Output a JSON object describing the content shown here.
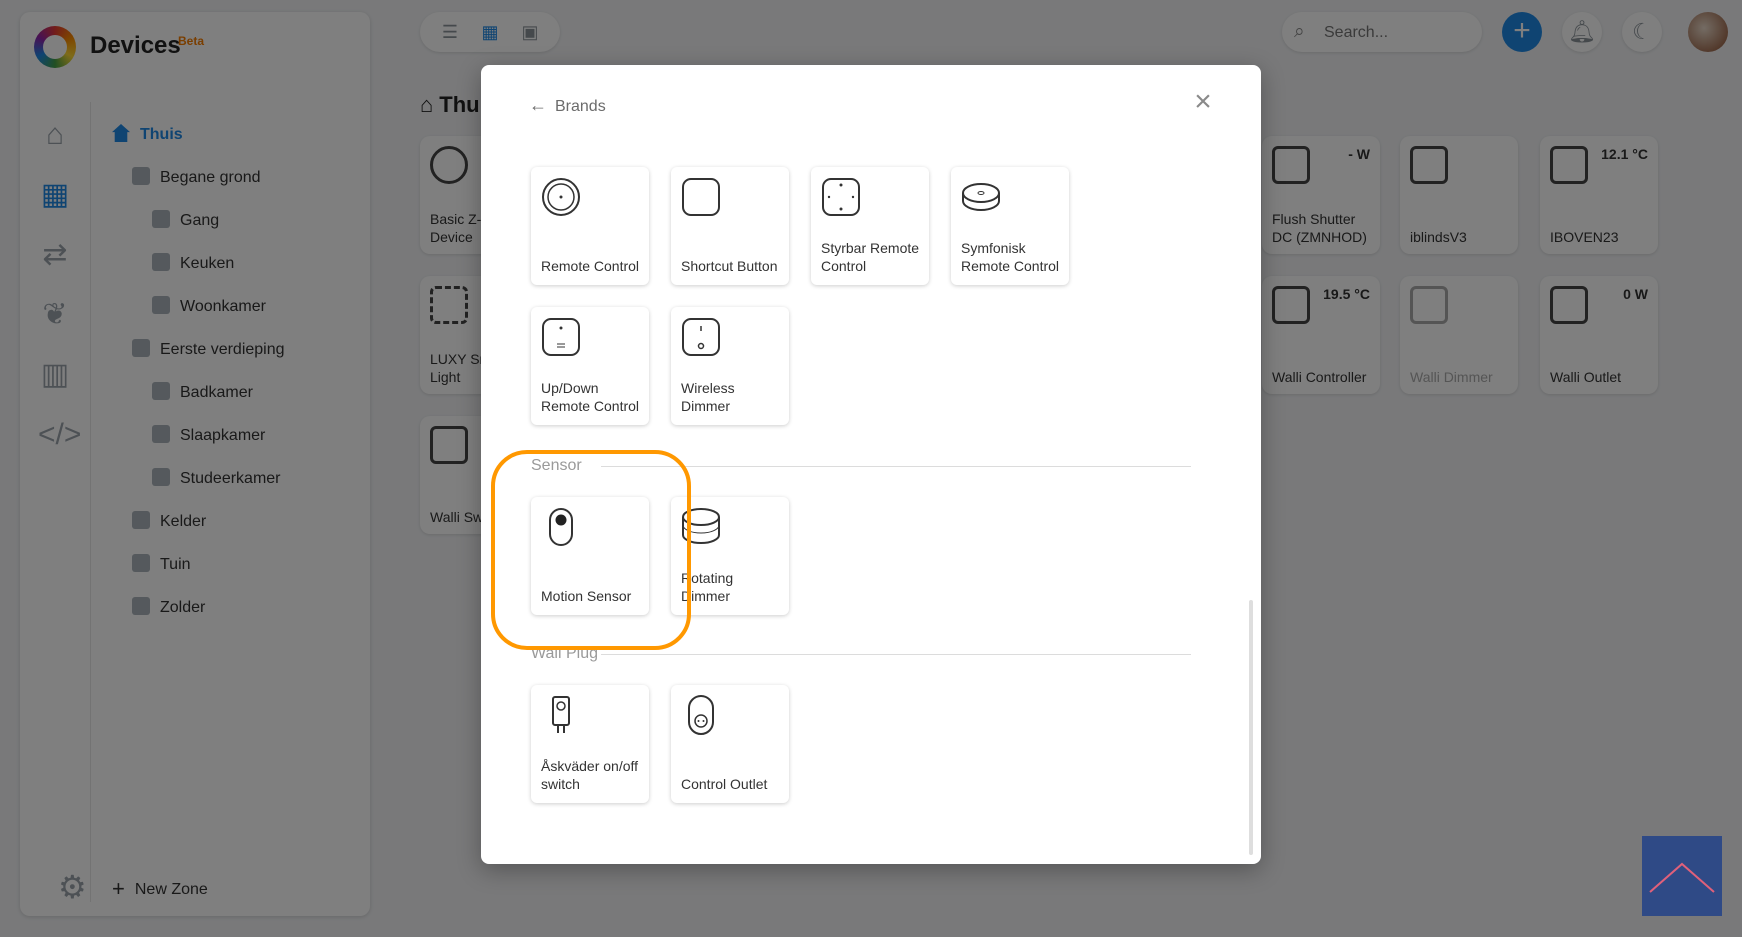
{
  "app": {
    "title": "Devices",
    "badge": "Beta",
    "accent_color": "#1e88e5",
    "highlight_color": "#ff9800"
  },
  "rail": [
    {
      "name": "home-icon",
      "active": false
    },
    {
      "name": "devices-grid-icon",
      "active": true
    },
    {
      "name": "flows-shuffle-icon",
      "active": false
    },
    {
      "name": "energy-leaf-icon",
      "active": false
    },
    {
      "name": "insights-chart-icon",
      "active": false
    },
    {
      "name": "developer-code-icon",
      "active": false
    }
  ],
  "zones": {
    "items": [
      {
        "label": "Thuis",
        "active": true
      },
      {
        "label": "Begane grond"
      },
      {
        "label": "Gang"
      },
      {
        "label": "Keuken"
      },
      {
        "label": "Woonkamer"
      },
      {
        "label": "Eerste verdieping"
      },
      {
        "label": "Badkamer"
      },
      {
        "label": "Slaapkamer"
      },
      {
        "label": "Studeerkamer"
      },
      {
        "label": "Kelder"
      },
      {
        "label": "Tuin"
      },
      {
        "label": "Zolder"
      }
    ],
    "new_zone_label": "New Zone"
  },
  "header": {
    "search_placeholder": "Search...",
    "zone_title": "Thu"
  },
  "devices": [
    {
      "name": "Basic Z-\nDevice",
      "value": ""
    },
    {
      "name": "LUXY Sn\nLight",
      "value": ""
    },
    {
      "name": "Walli Sw",
      "value": ""
    },
    {
      "name": "Flush Shutter\nDC (ZMNHOD)",
      "value": "- W"
    },
    {
      "name": "iblindsV3",
      "value": ""
    },
    {
      "name": "IBOVEN23",
      "value": "12.1 °C"
    },
    {
      "name": "Walli Controller",
      "value": "19.5 °C"
    },
    {
      "name": "Walli Dimmer",
      "value": ""
    },
    {
      "name": "Walli Outlet",
      "value": "0 W"
    }
  ],
  "modal": {
    "back_label": "Brands",
    "sections": [
      {
        "title": "",
        "items": [
          {
            "label": "Remote Control",
            "icon": "round-remote-icon"
          },
          {
            "label": "Shortcut Button",
            "icon": "shortcut-button-icon"
          },
          {
            "label": "Styrbar Remote Control",
            "icon": "styrbar-remote-icon"
          },
          {
            "label": "Symfonisk Remote Control",
            "icon": "symfonisk-remote-icon"
          },
          {
            "label": "Up/Down Remote Control",
            "icon": "updown-remote-icon"
          },
          {
            "label": "Wireless Dimmer",
            "icon": "wireless-dimmer-icon"
          }
        ]
      },
      {
        "title": "Sensor",
        "items": [
          {
            "label": "Motion Sensor",
            "icon": "motion-sensor-icon"
          },
          {
            "label": "Rotating Dimmer",
            "icon": "rotating-dimmer-icon"
          }
        ]
      },
      {
        "title": "Wall Plug",
        "items": [
          {
            "label": "Åskväder on/off switch",
            "icon": "askvader-switch-icon"
          },
          {
            "label": "Control Outlet",
            "icon": "control-outlet-icon"
          }
        ]
      }
    ]
  }
}
